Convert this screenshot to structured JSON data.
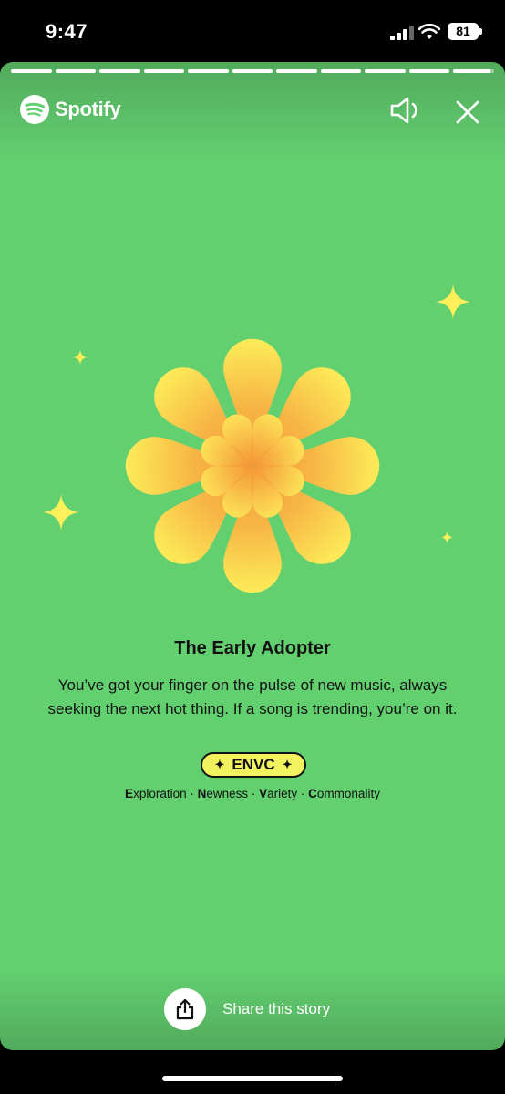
{
  "status_bar": {
    "time": "9:47",
    "battery": "81"
  },
  "header": {
    "brand": "Spotify",
    "progress": {
      "segments": 11,
      "active_index": 10,
      "active_fill": 0.9
    }
  },
  "content": {
    "title": "The Early Adopter",
    "description": "You’ve got your finger on the pulse of new music, always seeking the next hot thing. If a song is trending, you’re on it.",
    "code": "ENVC",
    "traits": [
      {
        "initial": "E",
        "rest": "xploration"
      },
      {
        "initial": "N",
        "rest": "ewness"
      },
      {
        "initial": "V",
        "rest": "ariety"
      },
      {
        "initial": "C",
        "rest": "ommonality"
      }
    ],
    "separator": " · "
  },
  "footer": {
    "share_label": "Share this story"
  },
  "colors": {
    "background": "#63d070",
    "petal_outer": "#fdf05a",
    "petal_inner": "#f6a33c",
    "pill": "#f2f15e"
  },
  "icons": {
    "logo": "spotify-logo-icon",
    "sound": "speaker-icon",
    "close": "close-icon",
    "share": "share-icon",
    "sparkles": "sparkle-icon"
  }
}
